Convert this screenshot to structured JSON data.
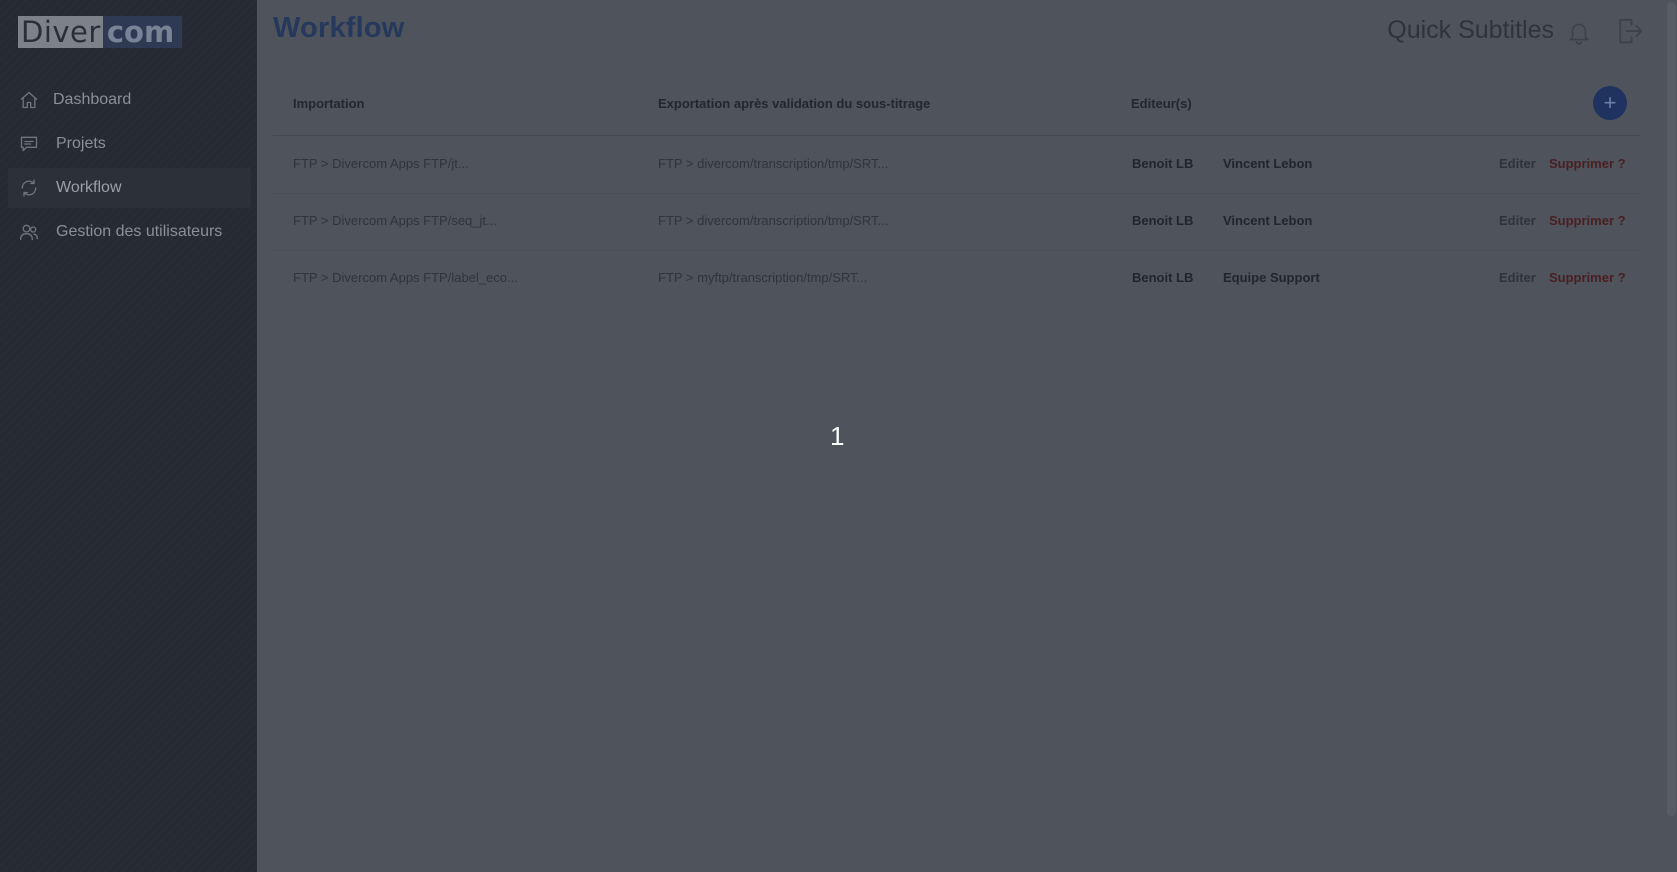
{
  "brand": {
    "logo_part1": "Diver",
    "logo_part2": "com"
  },
  "sidebar": {
    "items": [
      {
        "label": "Dashboard",
        "icon": "home-icon"
      },
      {
        "label": "Projets",
        "icon": "chat-icon"
      },
      {
        "label": "Workflow",
        "icon": "refresh-icon",
        "active": true
      },
      {
        "label": "Gestion des utilisateurs",
        "icon": "users-icon"
      }
    ]
  },
  "header": {
    "title": "Workflow",
    "app_name": "Quick Subtitles"
  },
  "table": {
    "columns": {
      "importation": "Importation",
      "exportation": "Exportation après validation du sous-titrage",
      "editors": "Editeur(s)"
    },
    "add_label": "+",
    "rows": [
      {
        "importation": "FTP > Divercom Apps FTP/jt...",
        "exportation": "FTP > divercom/transcription/tmp/SRT...",
        "editor1": "Benoit LB",
        "editor2": "Vincent Lebon",
        "edit": "Editer",
        "delete": "Supprimer ?"
      },
      {
        "importation": "FTP > Divercom Apps FTP/seq_jt...",
        "exportation": "FTP > divercom/transcription/tmp/SRT...",
        "editor1": "Benoit LB",
        "editor2": "Vincent Lebon",
        "edit": "Editer",
        "delete": "Supprimer ?"
      },
      {
        "importation": "FTP > Divercom Apps FTP/label_eco...",
        "exportation": "FTP > myftp/transcription/tmp/SRT...",
        "editor1": "Benoit LB",
        "editor2": "Equipe Support",
        "edit": "Editer",
        "delete": "Supprimer ?"
      }
    ]
  },
  "overlay": {
    "number": "1"
  },
  "colors": {
    "sidebar_bg": "#262a33",
    "main_bg": "#4e535c",
    "title": "#26385c",
    "accent": "#1f3260",
    "delete": "#4a1f22"
  }
}
